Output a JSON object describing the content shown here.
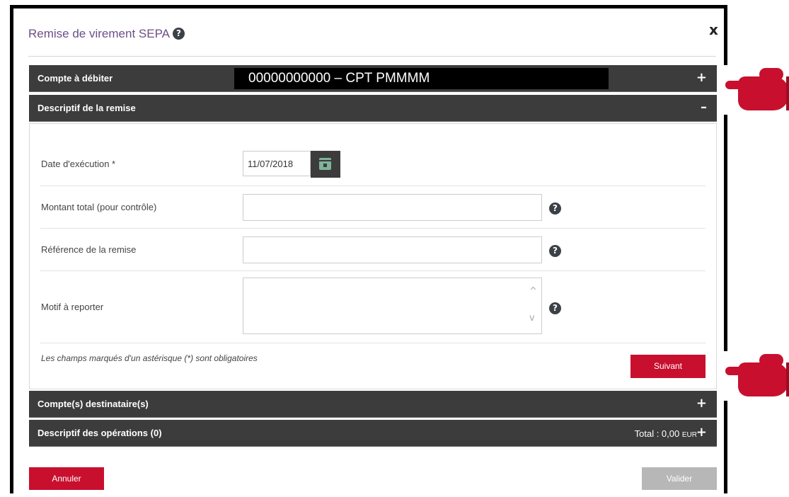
{
  "dialog": {
    "title": "Remise de virement SEPA",
    "help_glyph": "?",
    "close_glyph": "x"
  },
  "sections": {
    "compte_debiter": {
      "label": "Compte à débiter",
      "account": "00000000000 – CPT PMMMM",
      "toggle": "+"
    },
    "descriptif_remise": {
      "label": "Descriptif de la remise",
      "toggle": "–"
    },
    "comptes_destinataires": {
      "label": "Compte(s) destinataire(s)",
      "toggle": "+"
    },
    "descriptif_operations": {
      "label": "Descriptif des opérations (0)",
      "toggle": "+",
      "total_label": "Total : 0,00",
      "currency": "EUR"
    }
  },
  "form": {
    "date_label": "Date d'exécution *",
    "date_value": "11/07/2018",
    "montant_label": "Montant total (pour contrôle)",
    "montant_value": "",
    "reference_label": "Référence de la remise",
    "reference_value": "",
    "motif_label": "Motif à reporter",
    "motif_value": "",
    "required_note": "Les champs marqués d'un astérisque (*) sont obligatoires",
    "scroll_up": "^",
    "scroll_down": "v"
  },
  "buttons": {
    "suivant": "Suivant",
    "annuler": "Annuler",
    "valider": "Valider"
  },
  "colors": {
    "title": "#6b4f86",
    "bar": "#3c3c3c",
    "primary": "#c8102e",
    "disabled": "#b7b7b7"
  },
  "icons": {
    "help": "question-circle-icon",
    "calendar": "calendar-icon",
    "close": "close-icon",
    "pointer": "pointing-hand-icon"
  }
}
